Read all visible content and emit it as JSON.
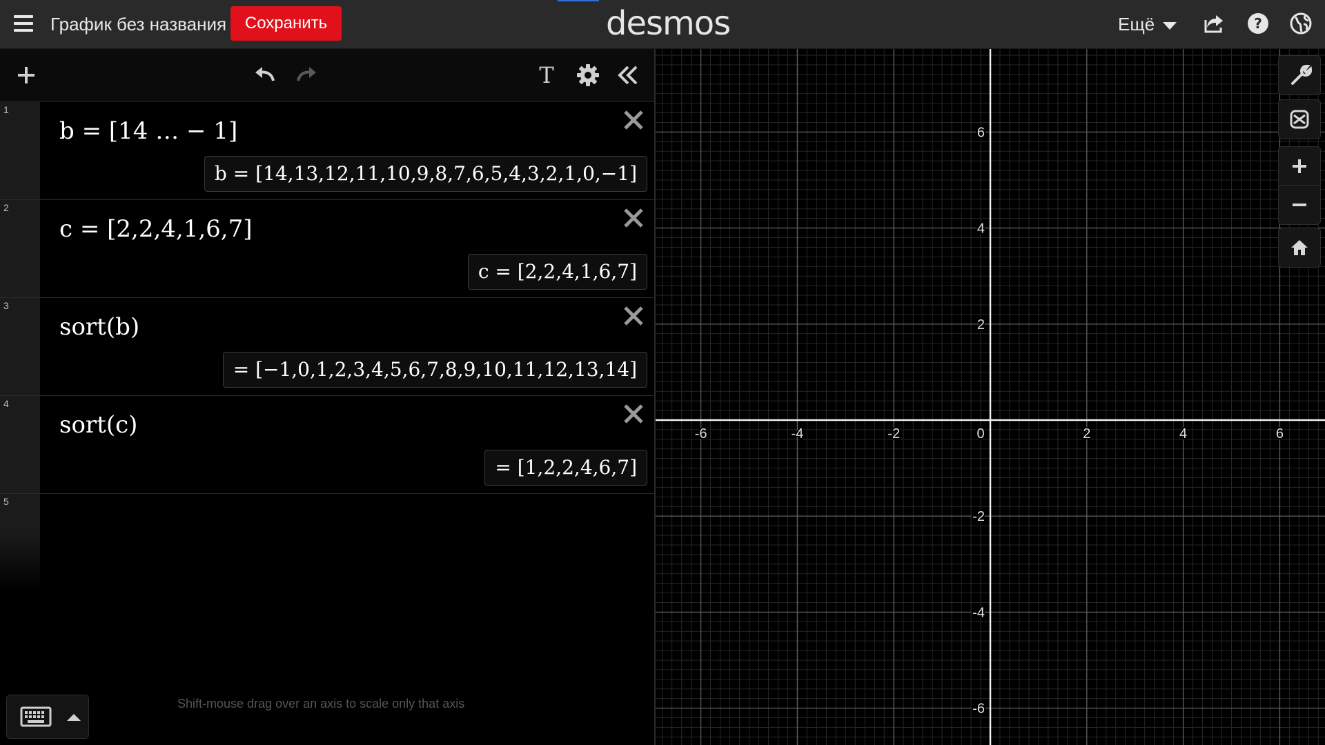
{
  "header": {
    "title": "График без названия",
    "save_label": "Сохранить",
    "logo": "desmos",
    "more_label": "Ещё"
  },
  "icons": {
    "menu": "hamburger-icon",
    "share": "share-icon",
    "help": "help-icon",
    "language": "globe-icon",
    "add": "plus-icon",
    "undo": "undo-icon",
    "redo": "redo-icon",
    "text": "text-icon",
    "settings": "gear-icon",
    "collapse": "double-chevron-left-icon",
    "keyboard": "keyboard-icon",
    "wrench": "wrench-icon",
    "zoom_in": "plus-icon",
    "zoom_out": "minus-icon",
    "home": "home-icon"
  },
  "toolbar": {
    "text_label": "T"
  },
  "expressions": [
    {
      "index": "1",
      "latex": "b = [14 … − 1]",
      "result": "b  =  [14,13,12,11,10,9,8,7,6,5,4,3,2,1,0,−1]"
    },
    {
      "index": "2",
      "latex": "c = [2,2,4,1,6,7]",
      "result": "c  =  [2,2,4,1,6,7]"
    },
    {
      "index": "3",
      "latex": "sort(b)",
      "result": "=  [−1,0,1,2,3,4,5,6,7,8,9,10,11,12,13,14]"
    },
    {
      "index": "4",
      "latex": "sort(c)",
      "result": "=  [1,2,2,4,6,7]"
    },
    {
      "index": "5",
      "latex": "",
      "result": ""
    }
  ],
  "hint": "Shift-mouse drag over an axis to scale only that axis",
  "graph": {
    "x_min": -7,
    "x_max": 7,
    "y_min": -7,
    "y_max": 7,
    "x_ticks": [
      "-6",
      "-4",
      "-2",
      "0",
      "2",
      "4",
      "6"
    ],
    "y_ticks": [
      "6",
      "4",
      "2",
      "-2",
      "-4",
      "-6"
    ],
    "grid": true
  },
  "colors": {
    "accent": "#2f72dc",
    "save": "#e0111a",
    "background": "#000000",
    "topbar": "#2a2a2a"
  }
}
